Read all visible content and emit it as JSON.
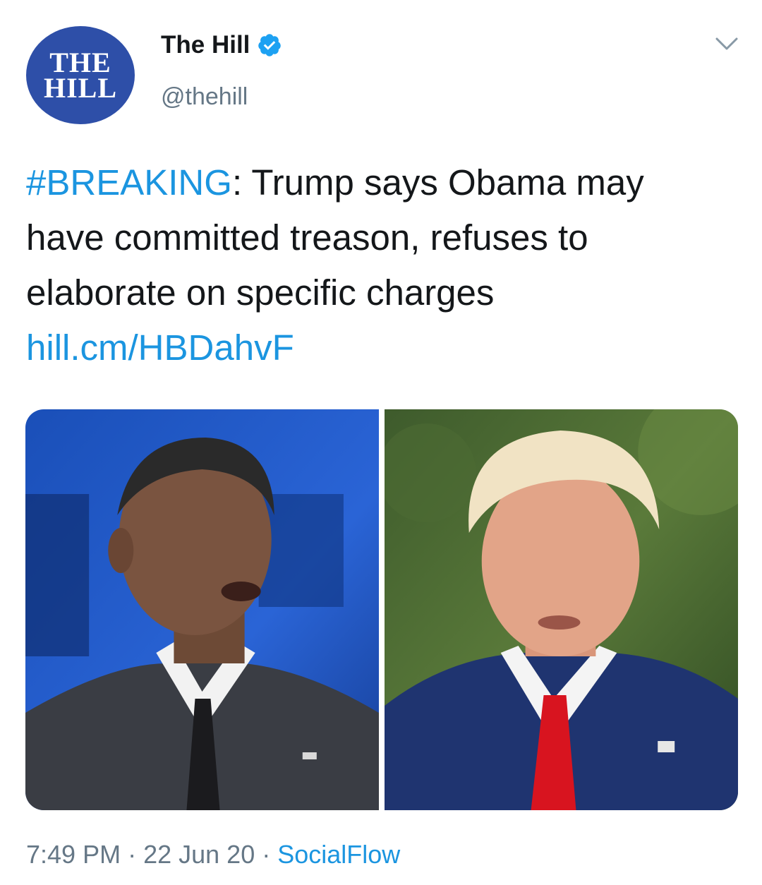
{
  "account": {
    "logo_line1": "THE",
    "logo_line2": "HILL",
    "display_name": "The Hill",
    "handle": "@thehill"
  },
  "tweet": {
    "hashtag": "#BREAKING",
    "text_after_hashtag": ": Trump says Obama may have committed treason, refuses to elaborate on specific charges ",
    "link": "hill.cm/HBDahvF"
  },
  "media": {
    "left_photo": "obama-photo",
    "right_photo": "trump-photo"
  },
  "meta": {
    "time": "7:49 PM",
    "separator": " · ",
    "date": "22 Jun 20",
    "source": "SocialFlow"
  },
  "colors": {
    "link": "#1b95e0",
    "secondary_text": "#657786",
    "logo_bg": "#2e4fa8",
    "verified": "#1da1f2"
  },
  "icons": {
    "verified": "verified-badge-icon",
    "caret": "chevron-down-icon"
  }
}
